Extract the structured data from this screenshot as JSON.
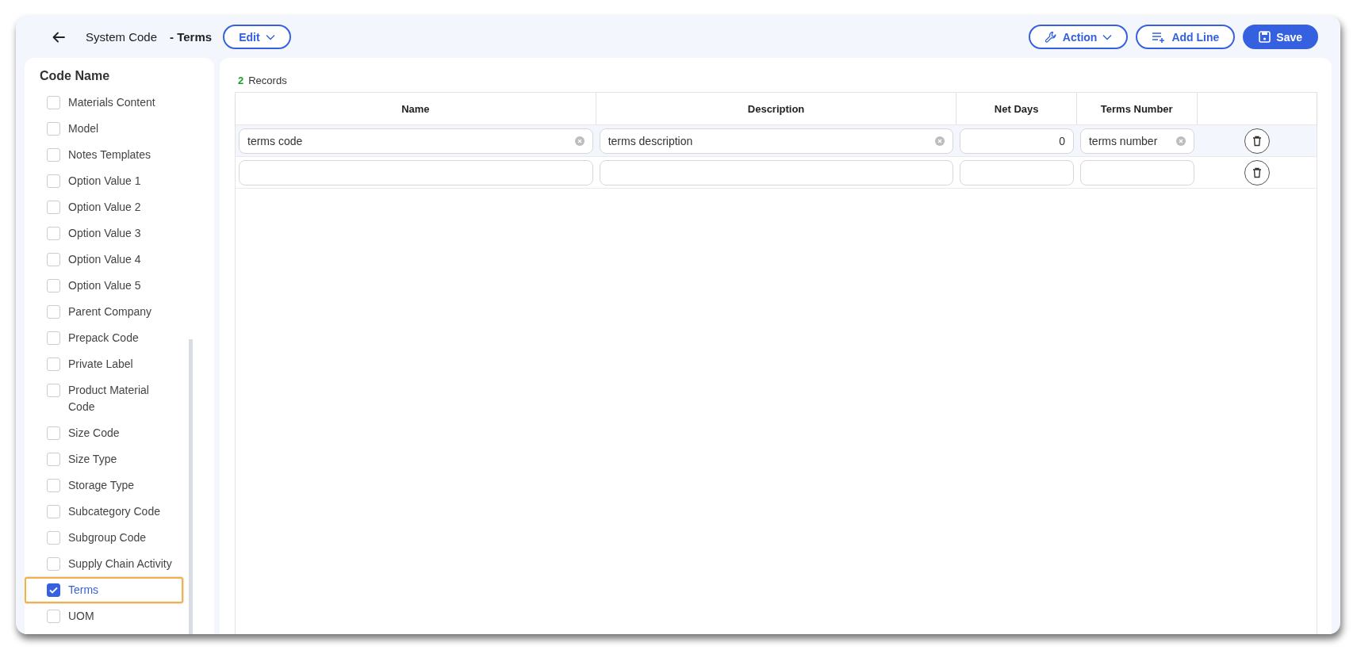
{
  "header": {
    "title": "System Code",
    "subtitle": "- Terms",
    "edit_button": "Edit",
    "actions": [
      {
        "kind": "outline",
        "label": "Action",
        "dropdown": true
      },
      {
        "kind": "outline",
        "label": "Add Line",
        "dropdown": false
      },
      {
        "kind": "primary",
        "label": "Save",
        "dropdown": false
      }
    ]
  },
  "sidebar": {
    "title": "Code Name",
    "items": [
      {
        "label": "Materials Content",
        "checked": false,
        "focused": false
      },
      {
        "label": "Model",
        "checked": false,
        "focused": false
      },
      {
        "label": "Notes Templates",
        "checked": false,
        "focused": false
      },
      {
        "label": "Option Value 1",
        "checked": false,
        "focused": false
      },
      {
        "label": "Option Value 2",
        "checked": false,
        "focused": false
      },
      {
        "label": "Option Value 3",
        "checked": false,
        "focused": false
      },
      {
        "label": "Option Value 4",
        "checked": false,
        "focused": false
      },
      {
        "label": "Option Value 5",
        "checked": false,
        "focused": false
      },
      {
        "label": "Parent Company",
        "checked": false,
        "focused": false
      },
      {
        "label": "Prepack Code",
        "checked": false,
        "focused": false
      },
      {
        "label": "Private Label",
        "checked": false,
        "focused": false
      },
      {
        "label": "Product Material Code",
        "checked": false,
        "focused": false
      },
      {
        "label": "Size Code",
        "checked": false,
        "focused": false
      },
      {
        "label": "Size Type",
        "checked": false,
        "focused": false
      },
      {
        "label": "Storage Type",
        "checked": false,
        "focused": false
      },
      {
        "label": "Subcategory Code",
        "checked": false,
        "focused": false
      },
      {
        "label": "Subgroup Code",
        "checked": false,
        "focused": false
      },
      {
        "label": "Supply Chain Activity",
        "checked": false,
        "focused": false
      },
      {
        "label": "Terms",
        "checked": true,
        "focused": true
      },
      {
        "label": "UOM",
        "checked": false,
        "focused": false
      }
    ]
  },
  "records": {
    "count": "2",
    "label": "Records"
  },
  "table": {
    "columns": [
      "Name",
      "Description",
      "Net Days",
      "Terms Number"
    ],
    "rows": [
      {
        "selected": true,
        "cells": [
          {
            "kind": "text",
            "value": "terms code"
          },
          {
            "kind": "text",
            "value": "terms description"
          },
          {
            "kind": "number",
            "value": "0"
          },
          {
            "kind": "text",
            "value": "terms number"
          }
        ]
      },
      {
        "selected": false,
        "cells": [
          {
            "kind": "text"
          },
          {
            "kind": "text"
          },
          {
            "kind": "number"
          },
          {
            "kind": "text"
          }
        ]
      }
    ]
  }
}
